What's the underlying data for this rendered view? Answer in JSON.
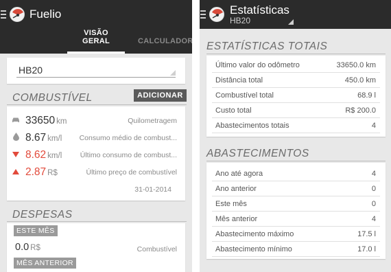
{
  "left": {
    "app_title": "Fuelio",
    "tabs": [
      {
        "label": "VISÃO GERAL",
        "active": true
      },
      {
        "label": "CALCULADORA",
        "active": false
      }
    ],
    "vehicle_select": {
      "value": "HB20"
    },
    "fuel_section": {
      "header": "COMBUSTÍVEL",
      "add_button": "ADICIONAR",
      "rows": [
        {
          "icon": "car-icon",
          "value": "33650",
          "unit": "km",
          "description": "Quilometragem",
          "highlight": false
        },
        {
          "icon": "drop-icon",
          "value": "8.67",
          "unit": "km/l",
          "description": "Consumo médio de combust...",
          "highlight": false
        },
        {
          "icon": "triangle-down-icon",
          "value": "8.62",
          "unit": "km/l",
          "description": "Último consumo de combust...",
          "highlight": true
        },
        {
          "icon": "triangle-up-icon",
          "value": "2.87",
          "unit": "R$",
          "description": "Último preço de combustível",
          "highlight": true
        }
      ],
      "date": "31-01-2014"
    },
    "expenses_section": {
      "header": "DESPESAS",
      "this_month_label": "ESTE MÊS",
      "this_month_value": "0.0",
      "this_month_unit": "R$",
      "this_month_desc": "Combustível",
      "last_month_label": "MÊS ANTERIOR"
    }
  },
  "right": {
    "title": "Estatísticas",
    "subtitle": "HB20",
    "totals_section": {
      "header": "ESTATÍSTICAS TOTAIS",
      "rows": [
        {
          "label": "Último valor do odômetro",
          "value": "33650.0 km"
        },
        {
          "label": "Distância total",
          "value": "450.0 km"
        },
        {
          "label": "Combustível total",
          "value": "68.9 l"
        },
        {
          "label": "Custo total",
          "value": "R$ 200.0"
        },
        {
          "label": "Abastecimentos totais",
          "value": "4"
        }
      ]
    },
    "refuel_section": {
      "header": "ABASTECIMENTOS",
      "rows": [
        {
          "label": "Ano até agora",
          "value": "4"
        },
        {
          "label": "Ano anterior",
          "value": "0"
        },
        {
          "label": "Este mês",
          "value": "0"
        },
        {
          "label": "Mês anterior",
          "value": "4"
        },
        {
          "label": "Abastecimento máximo",
          "value": "17.5 l"
        },
        {
          "label": "Abastecimento mínimo",
          "value": "17.0 l"
        }
      ]
    }
  },
  "colors": {
    "actionbar": "#2b2b2b",
    "background": "#e8e8e8",
    "highlight_red": "#e24a3b",
    "button_grey": "#5a5a5a"
  }
}
